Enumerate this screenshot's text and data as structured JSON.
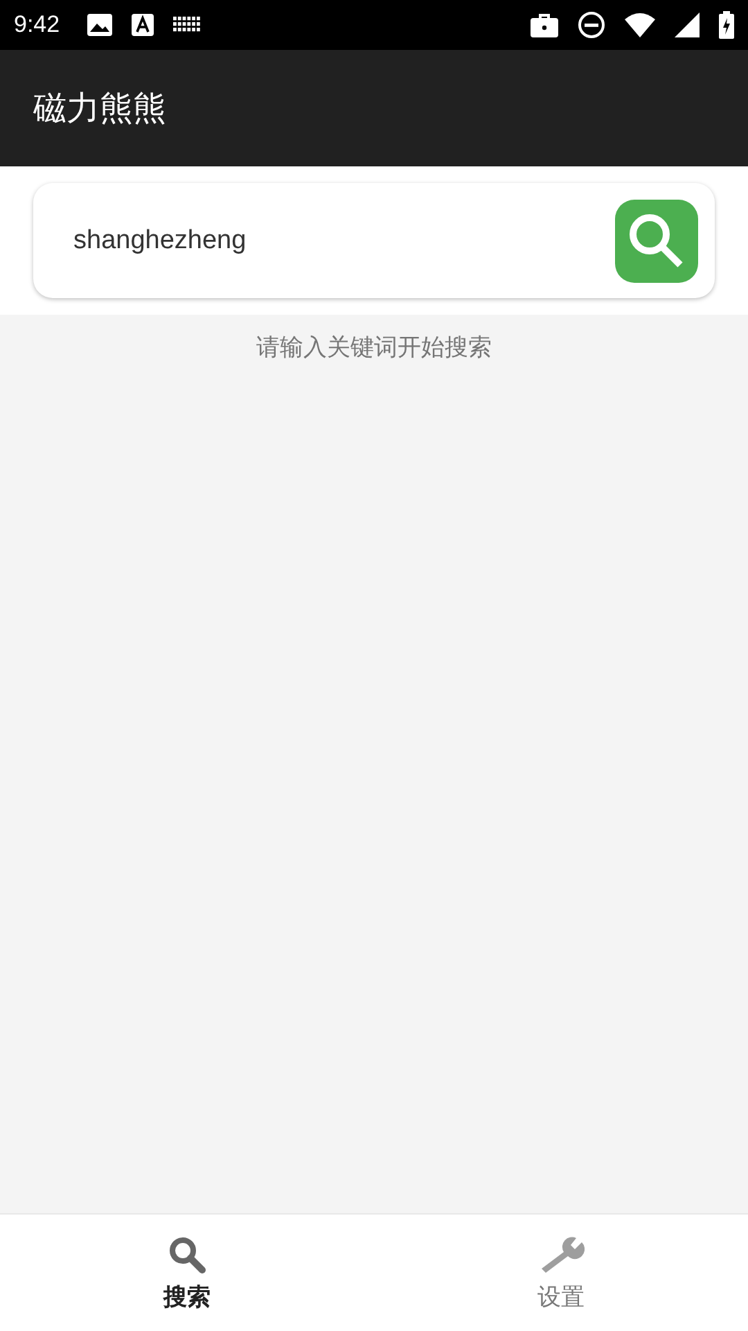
{
  "status_bar": {
    "time": "9:42"
  },
  "app_bar": {
    "title": "磁力熊熊"
  },
  "search": {
    "value": "shanghezheng"
  },
  "hint": "请输入关键词开始搜索",
  "tabs": [
    {
      "label": "搜索",
      "kind": "search",
      "selected": true
    },
    {
      "label": "设置",
      "kind": "settings",
      "selected": false
    }
  ]
}
